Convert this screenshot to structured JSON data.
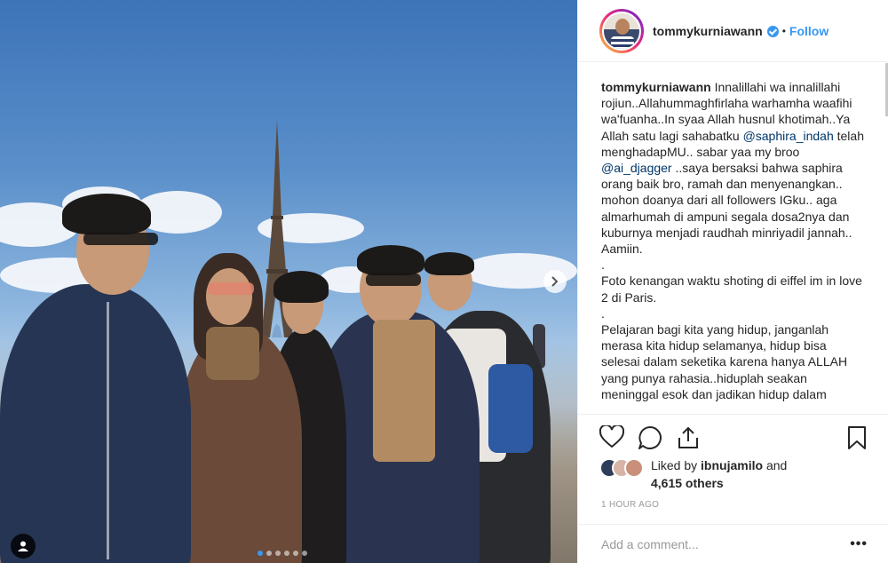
{
  "post": {
    "username": "tommykurniawann",
    "separator": "•",
    "follow_label": "Follow"
  },
  "caption": {
    "username": "tommykurniawann",
    "text_1": "Innalillahi wa innalillahi rojiun..Allahummaghfirlaha warhamha waafihi wa'fuanha..In syaa Allah husnul khotimah..Ya Allah satu lagi sahabatku",
    "mention_1": "@saphira_indah",
    "text_2": "telah menghadapMU.. sabar yaa my broo",
    "mention_2": "@ai_djagger",
    "text_3": "..saya bersaksi bahwa saphira orang baik bro, ramah dan menyenangkan.. mohon doanya dari all followers IGku.. aga almarhumah di ampuni segala dosa2nya dan kuburnya menjadi raudhah minriyadil jannah.. Aamiin.",
    "dot_1": ".",
    "para_2": "Foto kenangan waktu shoting di eiffel im in love 2 di Paris.",
    "dot_2": ".",
    "para_3": "Pelajaran bagi kita yang hidup, janganlah merasa kita hidup selamanya, hidup bisa selesai dalam seketika karena hanya ALLAH yang punya rahasia..hiduplah seakan meninggal esok dan jadikan hidup dalam"
  },
  "likes": {
    "prefix": "Liked by",
    "user": "ibnujamilo",
    "and": "and",
    "others": "4,615 others"
  },
  "timestamp": "1 HOUR AGO",
  "comment": {
    "placeholder": "Add a comment...",
    "more": "•••"
  },
  "carousel": {
    "slides": 6,
    "active_index": 0
  },
  "colors": {
    "link": "#3897f0",
    "mention": "#003569",
    "muted": "#999999"
  }
}
